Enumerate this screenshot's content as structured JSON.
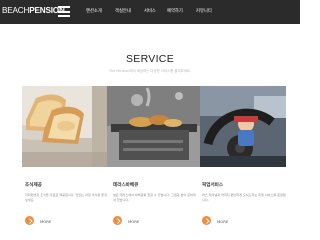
{
  "header": {
    "logo_light": "BEACH",
    "logo_bold": "PENSION",
    "nav": [
      {
        "label": "펜션소개"
      },
      {
        "label": "객실안내"
      },
      {
        "label": "서비스"
      },
      {
        "label": "예약하기"
      },
      {
        "label": "커뮤니티"
      }
    ]
  },
  "section": {
    "title": "SERVICE",
    "subtitle": "The Pension에서 제공하는 다양한 서비스를 즐겨보세요."
  },
  "cards": [
    {
      "title": "조식제공",
      "desc": "저희펜션은 조식을 무료로 제공합니다. 맛있는 아침 식사를 즐겨보세요.",
      "more": "MORE"
    },
    {
      "title": "테라스바베큐",
      "desc": "넓은 테라스에서 바베큐를 즐길 수 있습니다. 그릴과 숯이 준비되어 있습니다.",
      "more": "MORE"
    },
    {
      "title": "픽업서비스",
      "desc": "버스 터미널과 역까지 편안하게 모셔드리는 픽업 서비스를 운영합니다.",
      "more": "MORE"
    }
  ],
  "colors": {
    "header_bg": "#2b2b2b",
    "accent": "#f08c3c"
  },
  "icons": [
    "hamburger-icon",
    "chevron-right-icon"
  ]
}
